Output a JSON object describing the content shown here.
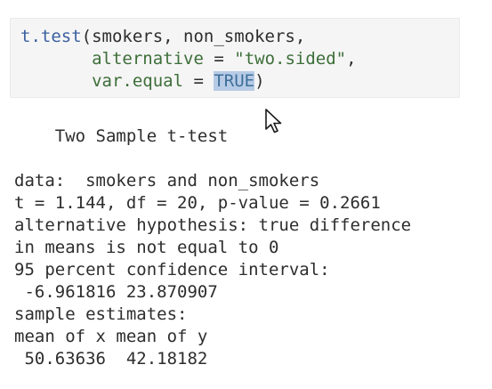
{
  "code": {
    "line1": {
      "fn": "t.test",
      "open_paren": "(",
      "args": "smokers, non_smokers,"
    },
    "line2": {
      "indent": "       ",
      "arg_name": "alternative",
      "equals": " = ",
      "arg_value": "\"two.sided\"",
      "comma": ","
    },
    "line3": {
      "indent": "       ",
      "arg_name": "var.equal",
      "equals": " = ",
      "selected_value": "TRUE",
      "close_paren": ")"
    }
  },
  "output": {
    "title": "    Two Sample t-test",
    "data_line": "data:  smokers and non_smokers",
    "stats_line": "t = 1.144, df = 20, p-value = 0.2661",
    "alt_hyp_1": "alternative hypothesis: true difference",
    "alt_hyp_2": "in means is not equal to 0",
    "ci_label": "95 percent confidence interval:",
    "ci_values": " -6.961816 23.870907",
    "estimates_label": "sample estimates:",
    "estimates_header": "mean of x mean of y",
    "estimates_values": " 50.63636  42.18182"
  },
  "colors": {
    "code_background": "#f5f5f5",
    "function_name": "#3a5fa0",
    "argument": "#3d6e39",
    "selection_highlight": "#b7cbe6"
  },
  "icons": {
    "cursor": "mouse-pointer-icon"
  }
}
